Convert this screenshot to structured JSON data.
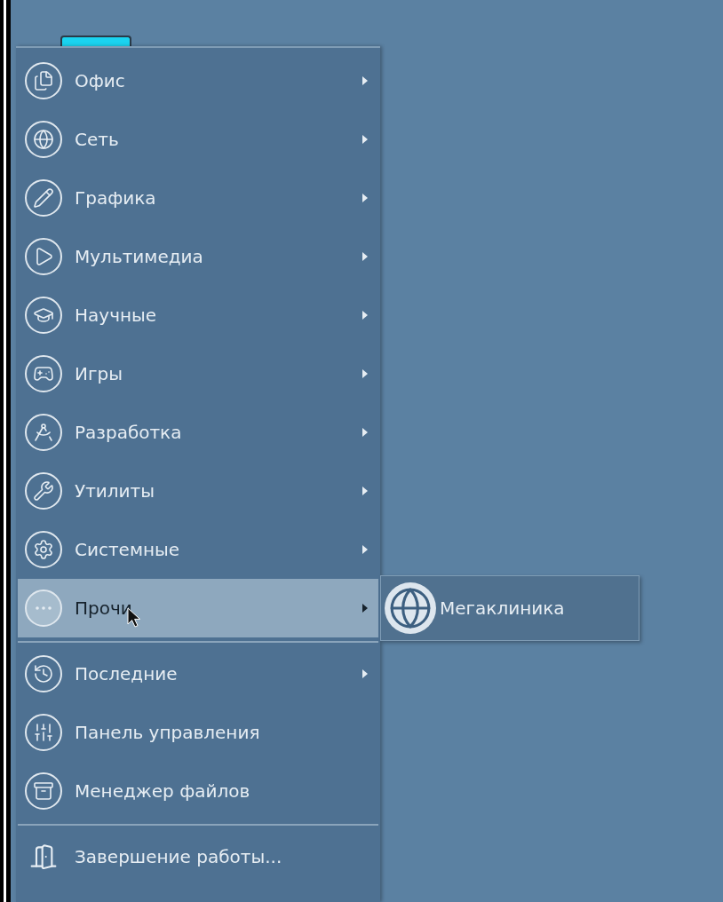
{
  "menu": {
    "sections": [
      {
        "items": [
          {
            "label": "Офис",
            "has_submenu": true,
            "selected": false
          },
          {
            "label": "Сеть",
            "has_submenu": true,
            "selected": false
          },
          {
            "label": "Графика",
            "has_submenu": true,
            "selected": false
          },
          {
            "label": "Мультимедиа",
            "has_submenu": true,
            "selected": false
          },
          {
            "label": "Научные",
            "has_submenu": true,
            "selected": false
          },
          {
            "label": "Игры",
            "has_submenu": true,
            "selected": false
          },
          {
            "label": "Разработка",
            "has_submenu": true,
            "selected": false
          },
          {
            "label": "Утилиты",
            "has_submenu": true,
            "selected": false
          },
          {
            "label": "Системные",
            "has_submenu": true,
            "selected": false
          },
          {
            "label": "Прочи",
            "has_submenu": true,
            "selected": true
          }
        ]
      },
      {
        "items": [
          {
            "label": "Последние",
            "has_submenu": true,
            "selected": false
          },
          {
            "label": "Панель управления",
            "has_submenu": false,
            "selected": false
          },
          {
            "label": "Менеджер файлов",
            "has_submenu": false,
            "selected": false
          }
        ]
      },
      {
        "items": [
          {
            "label": "Завершение работы...",
            "has_submenu": false,
            "selected": false
          }
        ]
      }
    ]
  },
  "submenu": {
    "items": [
      {
        "label": "Мегаклиника"
      }
    ]
  }
}
